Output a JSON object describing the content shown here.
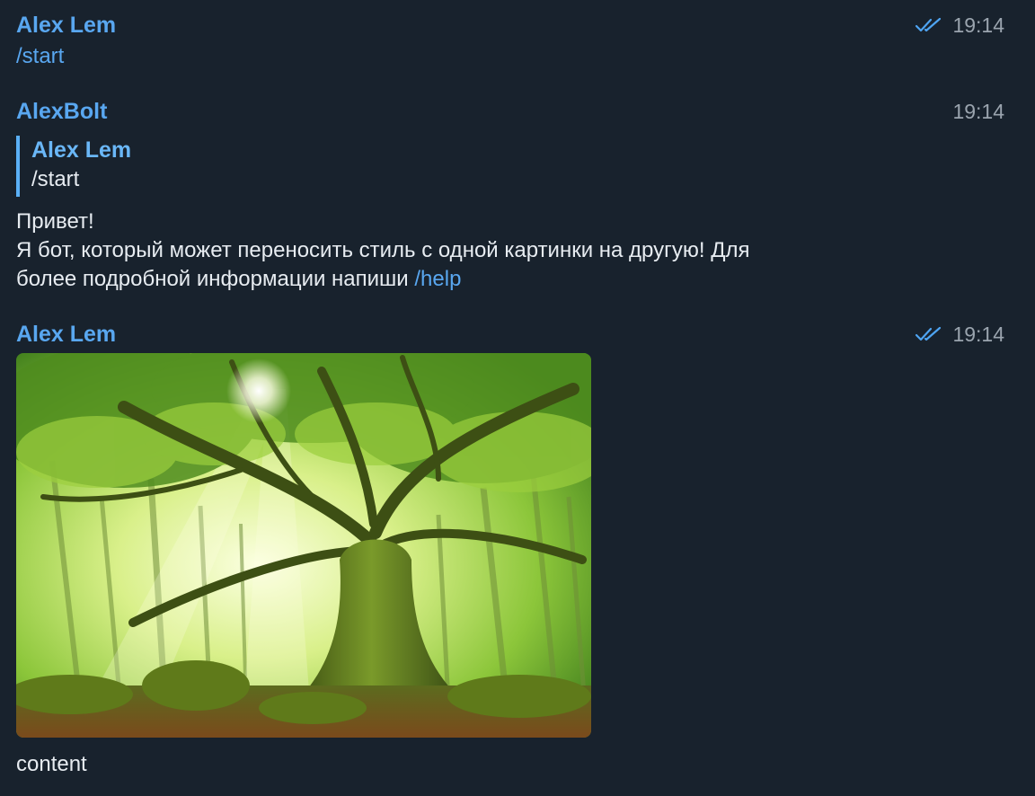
{
  "messages": [
    {
      "sender": "Alex Lem",
      "time": "19:14",
      "read_icon": "double-check-icon",
      "text": "/start"
    },
    {
      "sender": "AlexBolt",
      "time": "19:14",
      "reply": {
        "sender": "Alex Lem",
        "text": "/start"
      },
      "lines": [
        "Привет!",
        "Я бот, который может переносить стиль с одной картинки на другую! Для",
        "более подробной информации напиши "
      ],
      "link": "/help"
    },
    {
      "sender": "Alex Lem",
      "time": "19:14",
      "read_icon": "double-check-icon",
      "photo": "forest-tree-photo",
      "caption": "content"
    }
  ],
  "colors": {
    "background": "#18222d",
    "accent": "#59a7f0",
    "text": "#e7ecf1",
    "time": "#9aa4ae",
    "check": "#4ea4f2"
  }
}
